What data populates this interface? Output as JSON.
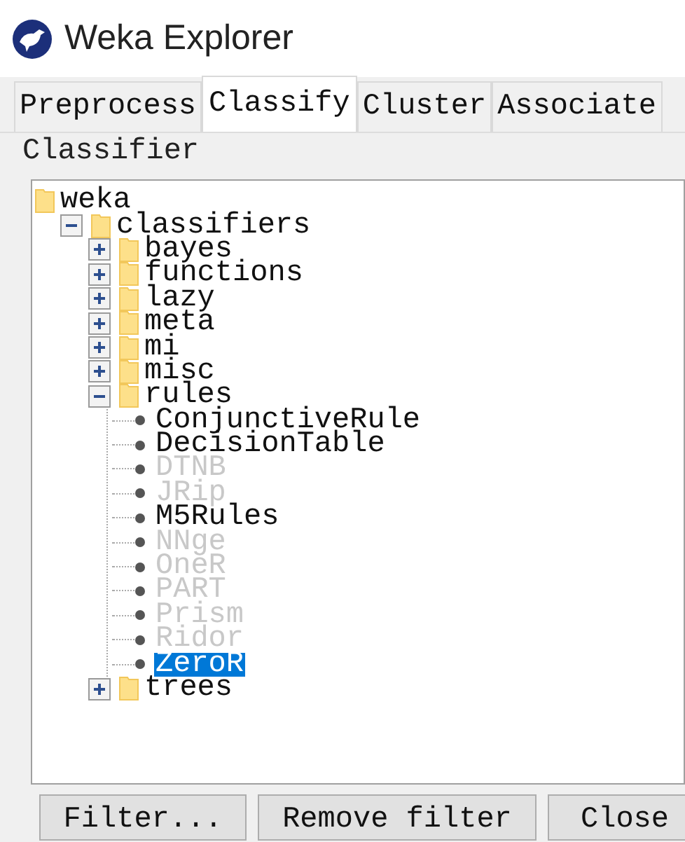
{
  "window": {
    "title": "Weka Explorer"
  },
  "tabs": [
    {
      "label": "Preprocess",
      "selected": false
    },
    {
      "label": "Classify",
      "selected": true
    },
    {
      "label": "Cluster",
      "selected": false
    },
    {
      "label": "Associate",
      "selected": false
    }
  ],
  "panel": {
    "title": "Classifier"
  },
  "tree": [
    {
      "kind": "folder",
      "label": "weka",
      "children": [
        {
          "kind": "folder",
          "label": "classifiers",
          "expanded": true,
          "children": [
            {
              "kind": "folder",
              "label": "bayes",
              "expanded": false
            },
            {
              "kind": "folder",
              "label": "functions",
              "expanded": false
            },
            {
              "kind": "folder",
              "label": "lazy",
              "expanded": false
            },
            {
              "kind": "folder",
              "label": "meta",
              "expanded": false
            },
            {
              "kind": "folder",
              "label": "mi",
              "expanded": false
            },
            {
              "kind": "folder",
              "label": "misc",
              "expanded": false
            },
            {
              "kind": "folder",
              "label": "rules",
              "expanded": true,
              "children": [
                {
                  "kind": "leaf",
                  "label": "ConjunctiveRule",
                  "disabled": false,
                  "selected": false
                },
                {
                  "kind": "leaf",
                  "label": "DecisionTable",
                  "disabled": false,
                  "selected": false
                },
                {
                  "kind": "leaf",
                  "label": "DTNB",
                  "disabled": true,
                  "selected": false
                },
                {
                  "kind": "leaf",
                  "label": "JRip",
                  "disabled": true,
                  "selected": false
                },
                {
                  "kind": "leaf",
                  "label": "M5Rules",
                  "disabled": false,
                  "selected": false
                },
                {
                  "kind": "leaf",
                  "label": "NNge",
                  "disabled": true,
                  "selected": false
                },
                {
                  "kind": "leaf",
                  "label": "OneR",
                  "disabled": true,
                  "selected": false
                },
                {
                  "kind": "leaf",
                  "label": "PART",
                  "disabled": true,
                  "selected": false
                },
                {
                  "kind": "leaf",
                  "label": "Prism",
                  "disabled": true,
                  "selected": false
                },
                {
                  "kind": "leaf",
                  "label": "Ridor",
                  "disabled": true,
                  "selected": false
                },
                {
                  "kind": "leaf",
                  "label": "ZeroR",
                  "disabled": false,
                  "selected": true
                }
              ]
            },
            {
              "kind": "folder",
              "label": "trees",
              "expanded": false
            }
          ]
        }
      ]
    }
  ],
  "buttons": [
    {
      "label": "Filter..."
    },
    {
      "label": "Remove filter"
    },
    {
      "label": "Close"
    }
  ]
}
